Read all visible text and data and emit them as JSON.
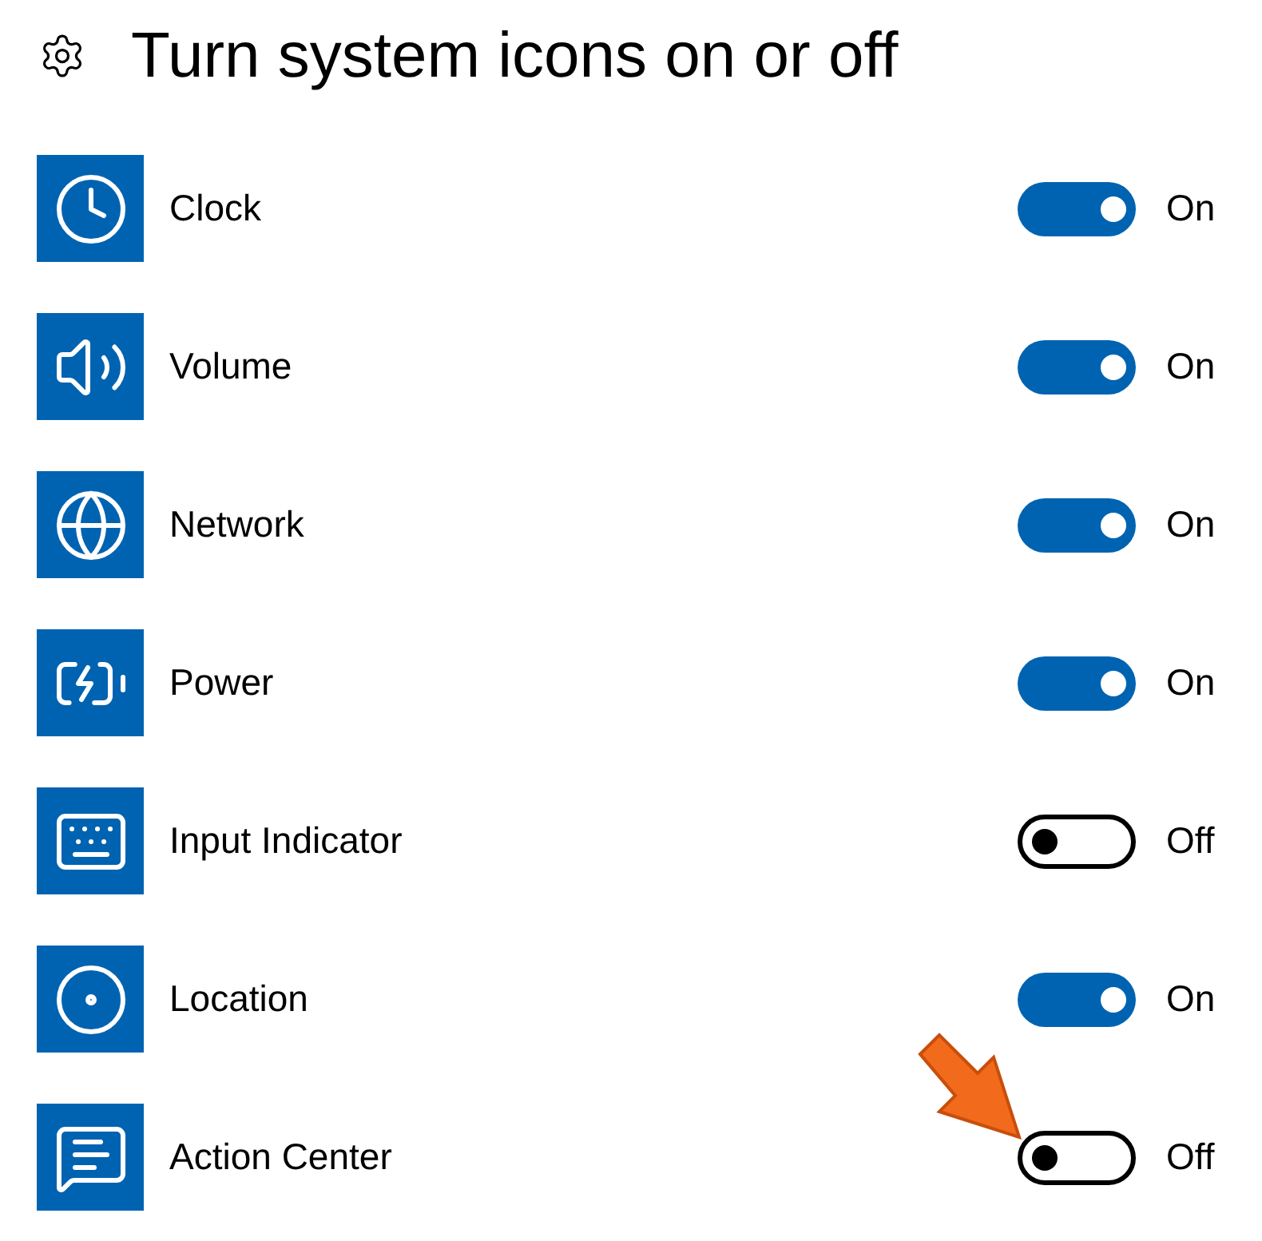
{
  "title": "Turn system icons on or off",
  "items": [
    {
      "label": "Clock",
      "on": true,
      "state": "On"
    },
    {
      "label": "Volume",
      "on": true,
      "state": "On"
    },
    {
      "label": "Network",
      "on": true,
      "state": "On"
    },
    {
      "label": "Power",
      "on": true,
      "state": "On"
    },
    {
      "label": "Input Indicator",
      "on": false,
      "state": "Off"
    },
    {
      "label": "Location",
      "on": true,
      "state": "On"
    },
    {
      "label": "Action Center",
      "on": false,
      "state": "Off"
    }
  ]
}
